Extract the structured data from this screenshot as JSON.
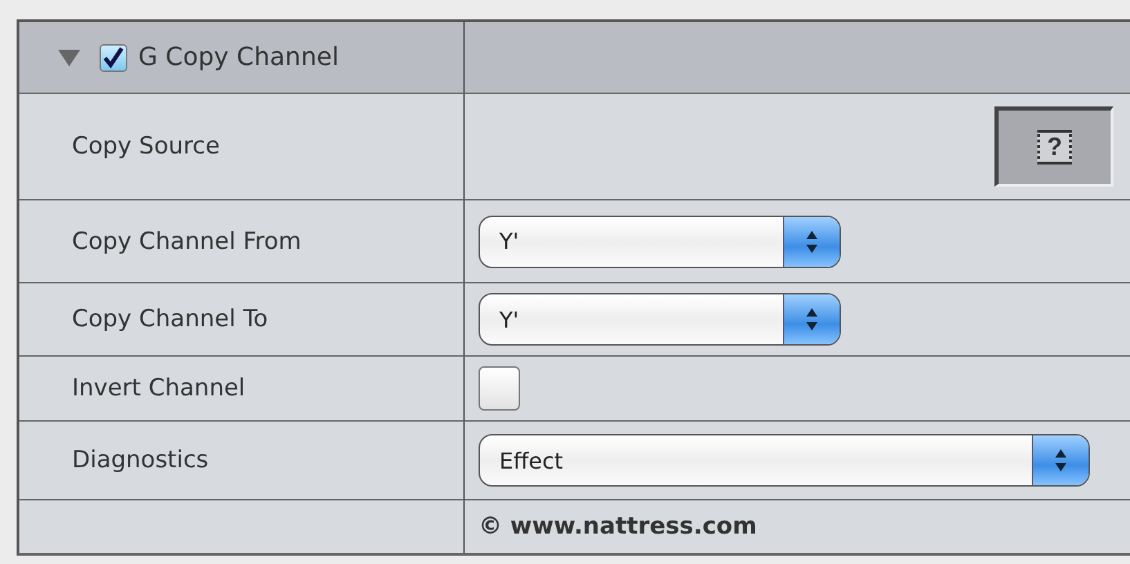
{
  "header": {
    "title": "G Copy Channel",
    "expanded": true,
    "enabled": true
  },
  "rows": [
    {
      "kind": "well",
      "label": "Copy Source",
      "glyph": "?"
    },
    {
      "kind": "popup",
      "label": "Copy Channel From",
      "value": "Y'",
      "wide": false
    },
    {
      "kind": "popup",
      "label": "Copy Channel To",
      "value": "Y'",
      "wide": false
    },
    {
      "kind": "checkbox",
      "label": "Invert Channel",
      "checked": false
    },
    {
      "kind": "popup",
      "label": "Diagnostics",
      "value": "Effect",
      "wide": true
    }
  ],
  "footer": "© www.nattress.com"
}
